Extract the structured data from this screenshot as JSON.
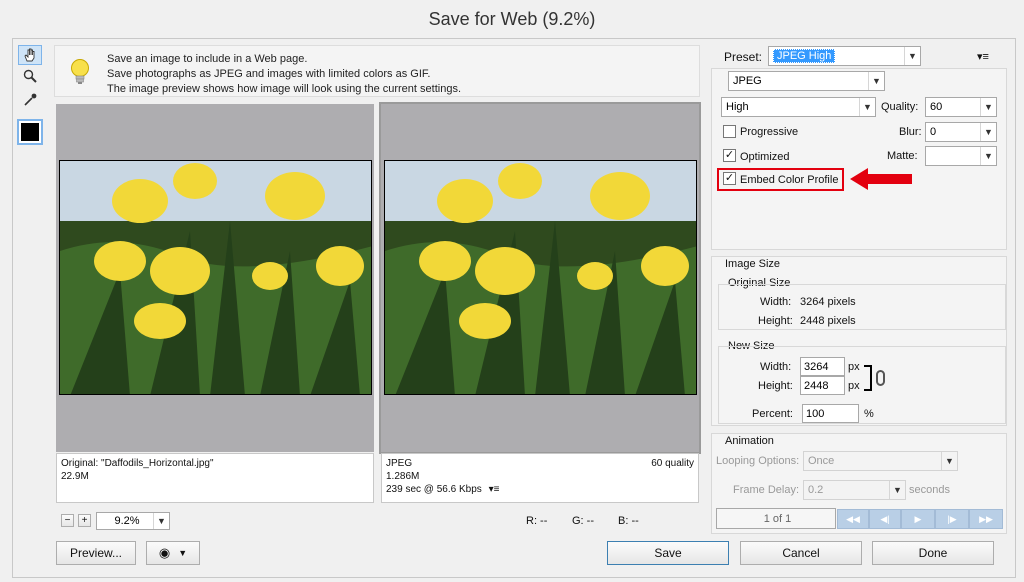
{
  "window": {
    "title": "Save for Web (9.2%)"
  },
  "info": {
    "lines": [
      "Save an image to include in a Web page.",
      "Save photographs as JPEG and images with limited colors as GIF.",
      "The image preview shows how image will look using the current settings."
    ]
  },
  "tools": [
    "hand-icon",
    "zoom-icon",
    "eyedropper-icon"
  ],
  "original": {
    "label": "Original: \"Daffodils_Horizontal.jpg\"",
    "size": "22.9M"
  },
  "optimized": {
    "format": "JPEG",
    "quality": "60 quality",
    "size": "1.286M",
    "time": "239 sec @ 56.6 Kbps",
    "menu_glyph": "▾≡"
  },
  "zoom": {
    "minus": "−",
    "plus": "+",
    "value": "9.2%"
  },
  "readout": {
    "r": "R: --",
    "g": "G: --",
    "b": "B: --"
  },
  "buttons": {
    "preview": "Preview...",
    "save": "Save",
    "cancel": "Cancel",
    "done": "Done"
  },
  "settings": {
    "preset_label": "Preset:",
    "preset_value": "JPEG High",
    "format": "JPEG",
    "compression": "High",
    "quality_label": "Quality:",
    "quality_value": "60",
    "progressive_label": "Progressive",
    "progressive_checked": false,
    "blur_label": "Blur:",
    "blur_value": "0",
    "optimized_label": "Optimized",
    "optimized_checked": true,
    "matte_label": "Matte:",
    "matte_value": "",
    "embed_label": "Embed Color Profile",
    "embed_checked": true,
    "check_glyph": "✓",
    "menu_glyph": "▾≡"
  },
  "image_size": {
    "heading": "Image Size",
    "original_heading": "Original Size",
    "orig_width_label": "Width:",
    "orig_width_value": "3264 pixels",
    "orig_height_label": "Height:",
    "orig_height_value": "2448 pixels",
    "new_heading": "New Size",
    "width_label": "Width:",
    "width_value": "3264",
    "height_label": "Height:",
    "height_value": "2448",
    "unit": "px",
    "percent_label": "Percent:",
    "percent_value": "100",
    "percent_unit": "%"
  },
  "animation": {
    "heading": "Animation",
    "looping_label": "Looping Options:",
    "looping_value": "Once",
    "delay_label": "Frame Delay:",
    "delay_value": "0.2",
    "delay_unit": "seconds",
    "frame_counter": "1 of 1",
    "nav": [
      "◀◀",
      "◀|",
      "▶",
      "|▶",
      "▶▶"
    ]
  },
  "colors": {
    "accent": "#3c7fb1",
    "highlight": "#e3000f",
    "preset_bg": "#3399ff"
  }
}
